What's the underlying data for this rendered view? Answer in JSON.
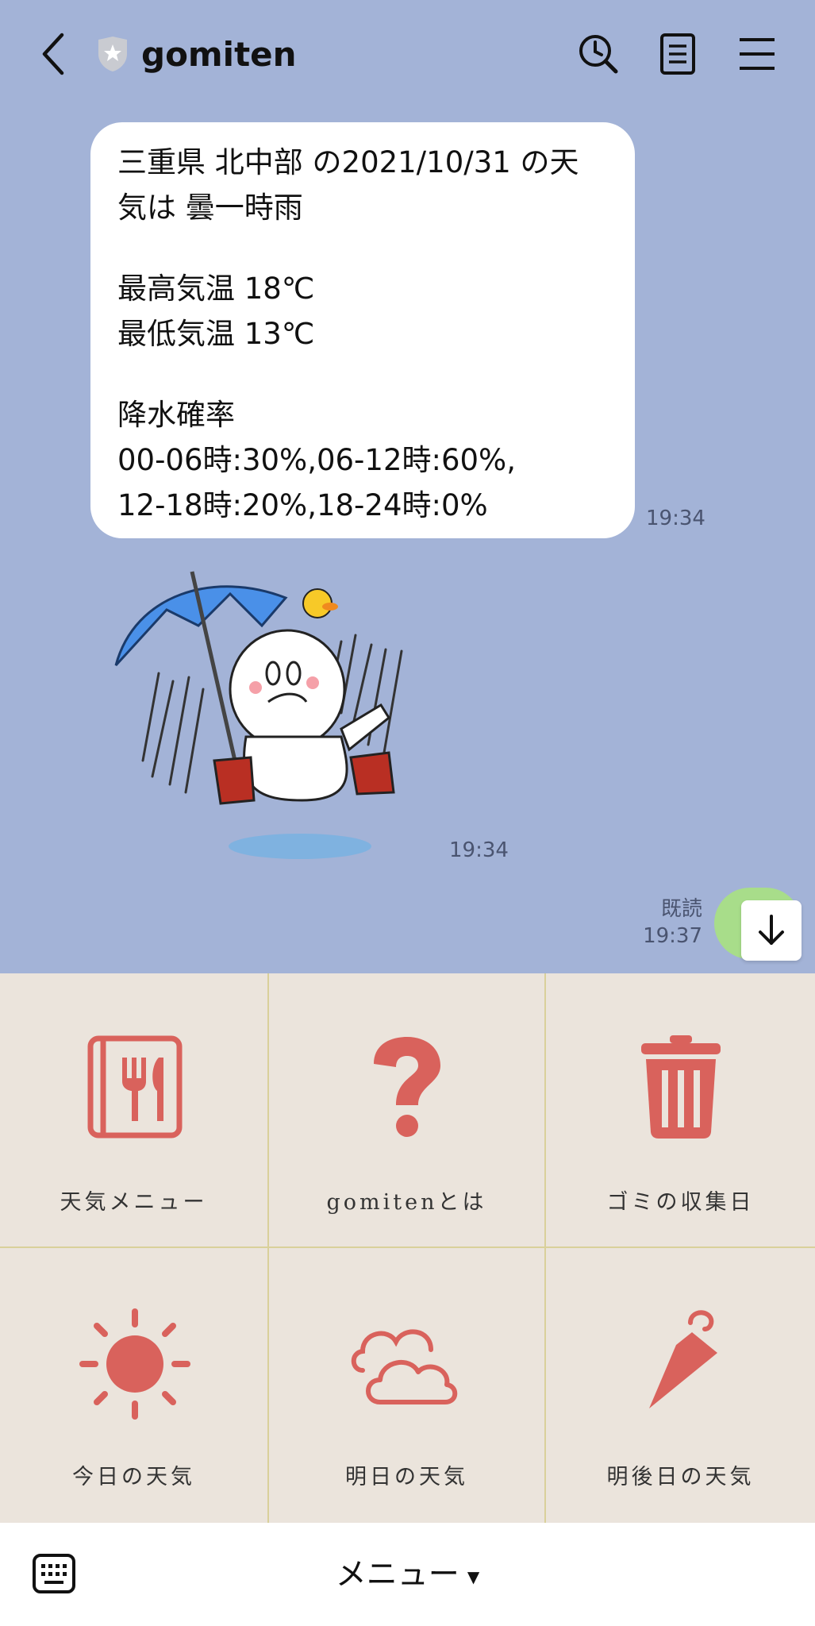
{
  "header": {
    "title": "gomiten",
    "back_icon": "back-arrow-icon",
    "search_icon": "clock-search-icon",
    "notes_icon": "notes-icon",
    "menu_icon": "hamburger-icon"
  },
  "message": {
    "lines": [
      "三重県 北中部 の2021/10/31 の天",
      "気は 曇一時雨",
      "",
      "最高気温 18℃",
      "最低気温 13℃",
      "",
      "降水確率",
      "00-06時:30%,06-12時:60%,",
      "12-18時:20%,18-24時:0%"
    ],
    "time": "19:34"
  },
  "sticker": {
    "time": "19:34",
    "icon": "umbrella-character-sticker"
  },
  "sent": {
    "read_label": "既読",
    "time": "19:37"
  },
  "menu": {
    "items": [
      {
        "label": "天気メニュー",
        "icon": "menu-book-icon"
      },
      {
        "label": "gomitenとは",
        "icon": "question-icon"
      },
      {
        "label": "ゴミの収集日",
        "icon": "trash-icon"
      },
      {
        "label": "今日の天気",
        "icon": "sun-icon"
      },
      {
        "label": "明日の天気",
        "icon": "cloud-icon"
      },
      {
        "label": "明後日の天気",
        "icon": "umbrella-icon"
      }
    ],
    "accent": "#d9625c"
  },
  "bottom": {
    "toggle_label": "メニュー",
    "keyboard_icon": "keyboard-icon"
  }
}
